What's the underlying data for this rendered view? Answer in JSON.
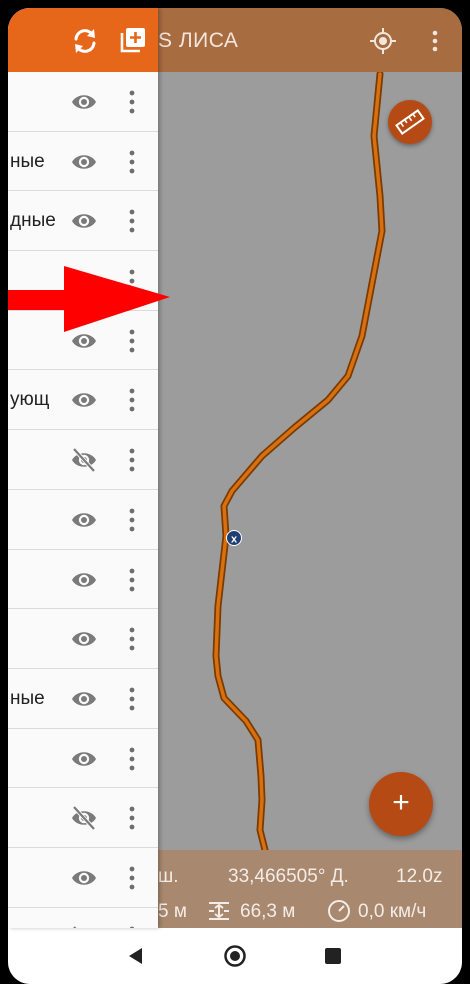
{
  "app_bar": {
    "title": "S ЛИСА",
    "icons": [
      "sync-icon",
      "add-layer-icon",
      "my-location-icon",
      "overflow-menu-icon"
    ]
  },
  "layers": [
    {
      "name": "",
      "visible": true
    },
    {
      "name": "ные",
      "visible": true
    },
    {
      "name": "дные",
      "visible": true
    },
    {
      "name": "",
      "visible": true
    },
    {
      "name": "",
      "visible": true
    },
    {
      "name": "ующ",
      "visible": true
    },
    {
      "name": "",
      "visible": false
    },
    {
      "name": "",
      "visible": true
    },
    {
      "name": "",
      "visible": true
    },
    {
      "name": "",
      "visible": true
    },
    {
      "name": "ные",
      "visible": true
    },
    {
      "name": "",
      "visible": true
    },
    {
      "name": "",
      "visible": false
    },
    {
      "name": "",
      "visible": true
    },
    {
      "name": "",
      "visible": false
    }
  ],
  "info": {
    "lat": "ш.",
    "lon": "33,466505° Д.",
    "zoom": "12.0z",
    "distance_a": "5 м",
    "distance_b": "66,3 м",
    "speed": "0,0 км/ч"
  },
  "colors": {
    "accent": "#e6661a",
    "fab": "#b64a14",
    "track": "#cc6a00",
    "arrow": "#ff0000"
  },
  "nav": [
    "back-icon",
    "home-icon",
    "recents-icon"
  ]
}
